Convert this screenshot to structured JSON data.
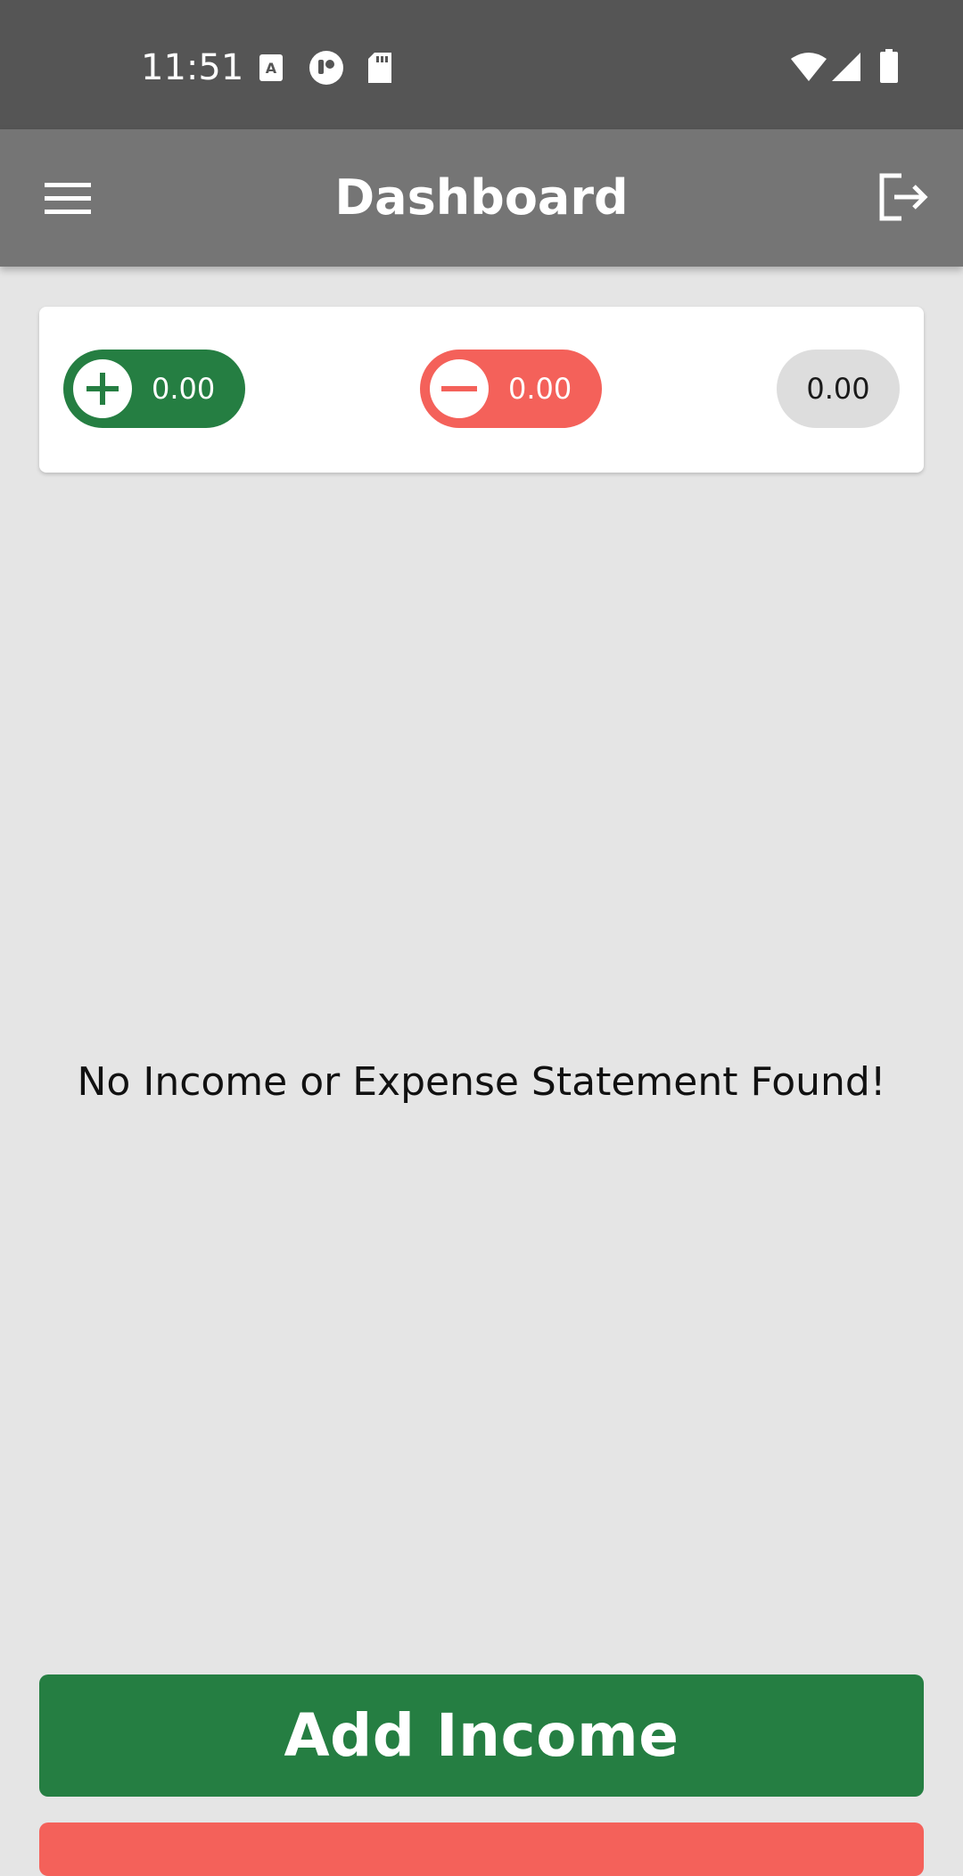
{
  "status_bar": {
    "time": "11:51",
    "icons": [
      "text-notification-icon",
      "app-notification-icon",
      "sd-card-icon",
      "wifi-icon",
      "cell-signal-icon",
      "battery-icon"
    ]
  },
  "app_bar": {
    "title": "Dashboard",
    "menu_icon": "hamburger-menu-icon",
    "logout_icon": "logout-icon"
  },
  "summary": {
    "income": {
      "value": "0.00",
      "icon": "plus-circle-icon"
    },
    "expense": {
      "value": "0.00",
      "icon": "minus-circle-icon"
    },
    "balance": {
      "value": "0.00"
    }
  },
  "main": {
    "empty_message": "No Income or Expense Statement Found!"
  },
  "actions": {
    "add_income_label": "Add Income",
    "add_expense_label": ""
  },
  "colors": {
    "status_bar": "#555555",
    "app_bar": "#757575",
    "background": "#e5e5e5",
    "income_green": "#257e42",
    "expense_red": "#f4615a",
    "balance_gray": "#dddddd"
  }
}
